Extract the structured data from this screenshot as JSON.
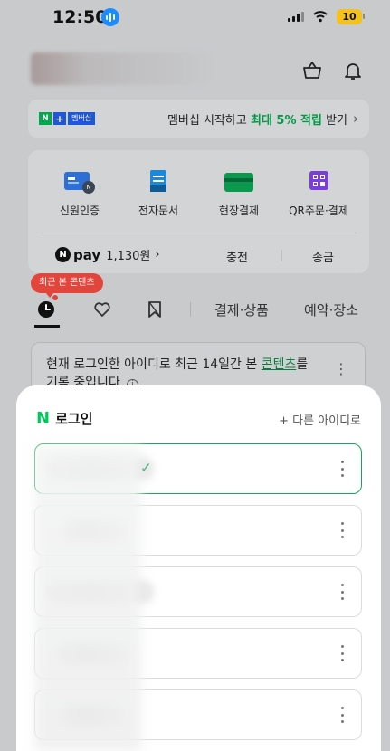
{
  "status_bar": {
    "time": "12:50",
    "battery": "10"
  },
  "banner": {
    "badge_n": "N",
    "badge_plus": "+",
    "badge_label": "멤버십",
    "text_before": "멤버십 시작하고 ",
    "highlight": "최대 5% 적립",
    "text_after": " 받기",
    "chevron": "›"
  },
  "services": [
    {
      "label": "신원인증",
      "icon": "id-card-icon"
    },
    {
      "label": "전자문서",
      "icon": "document-icon"
    },
    {
      "label": "현장결제",
      "icon": "card-icon"
    },
    {
      "label": "QR주문·결제",
      "icon": "qr-icon"
    }
  ],
  "pay": {
    "logo_letter": "N",
    "logo_word": "pay",
    "amount": "1,130원",
    "chevron": "›",
    "charge": "충전",
    "send": "송금"
  },
  "recent_tip": "최근 본 콘텐츠",
  "tabs": {
    "payment_products": "결제·상품",
    "reservation_places": "예약·장소"
  },
  "notice": {
    "text_before": "현재 로그인한 아이디로 최근 14일간 본 ",
    "link": "콘텐츠",
    "text_after": "를",
    "line2": "기록 중입니다.",
    "info": "i",
    "more": "⋮"
  },
  "sheet": {
    "logo": "N",
    "title": "로그인",
    "other_id": "+ 다른 아이디로",
    "check": "✓"
  },
  "colors": {
    "naver_green": "#03c75a",
    "accent_blue": "#1f57d8",
    "tooltip_red": "#e2453c"
  }
}
